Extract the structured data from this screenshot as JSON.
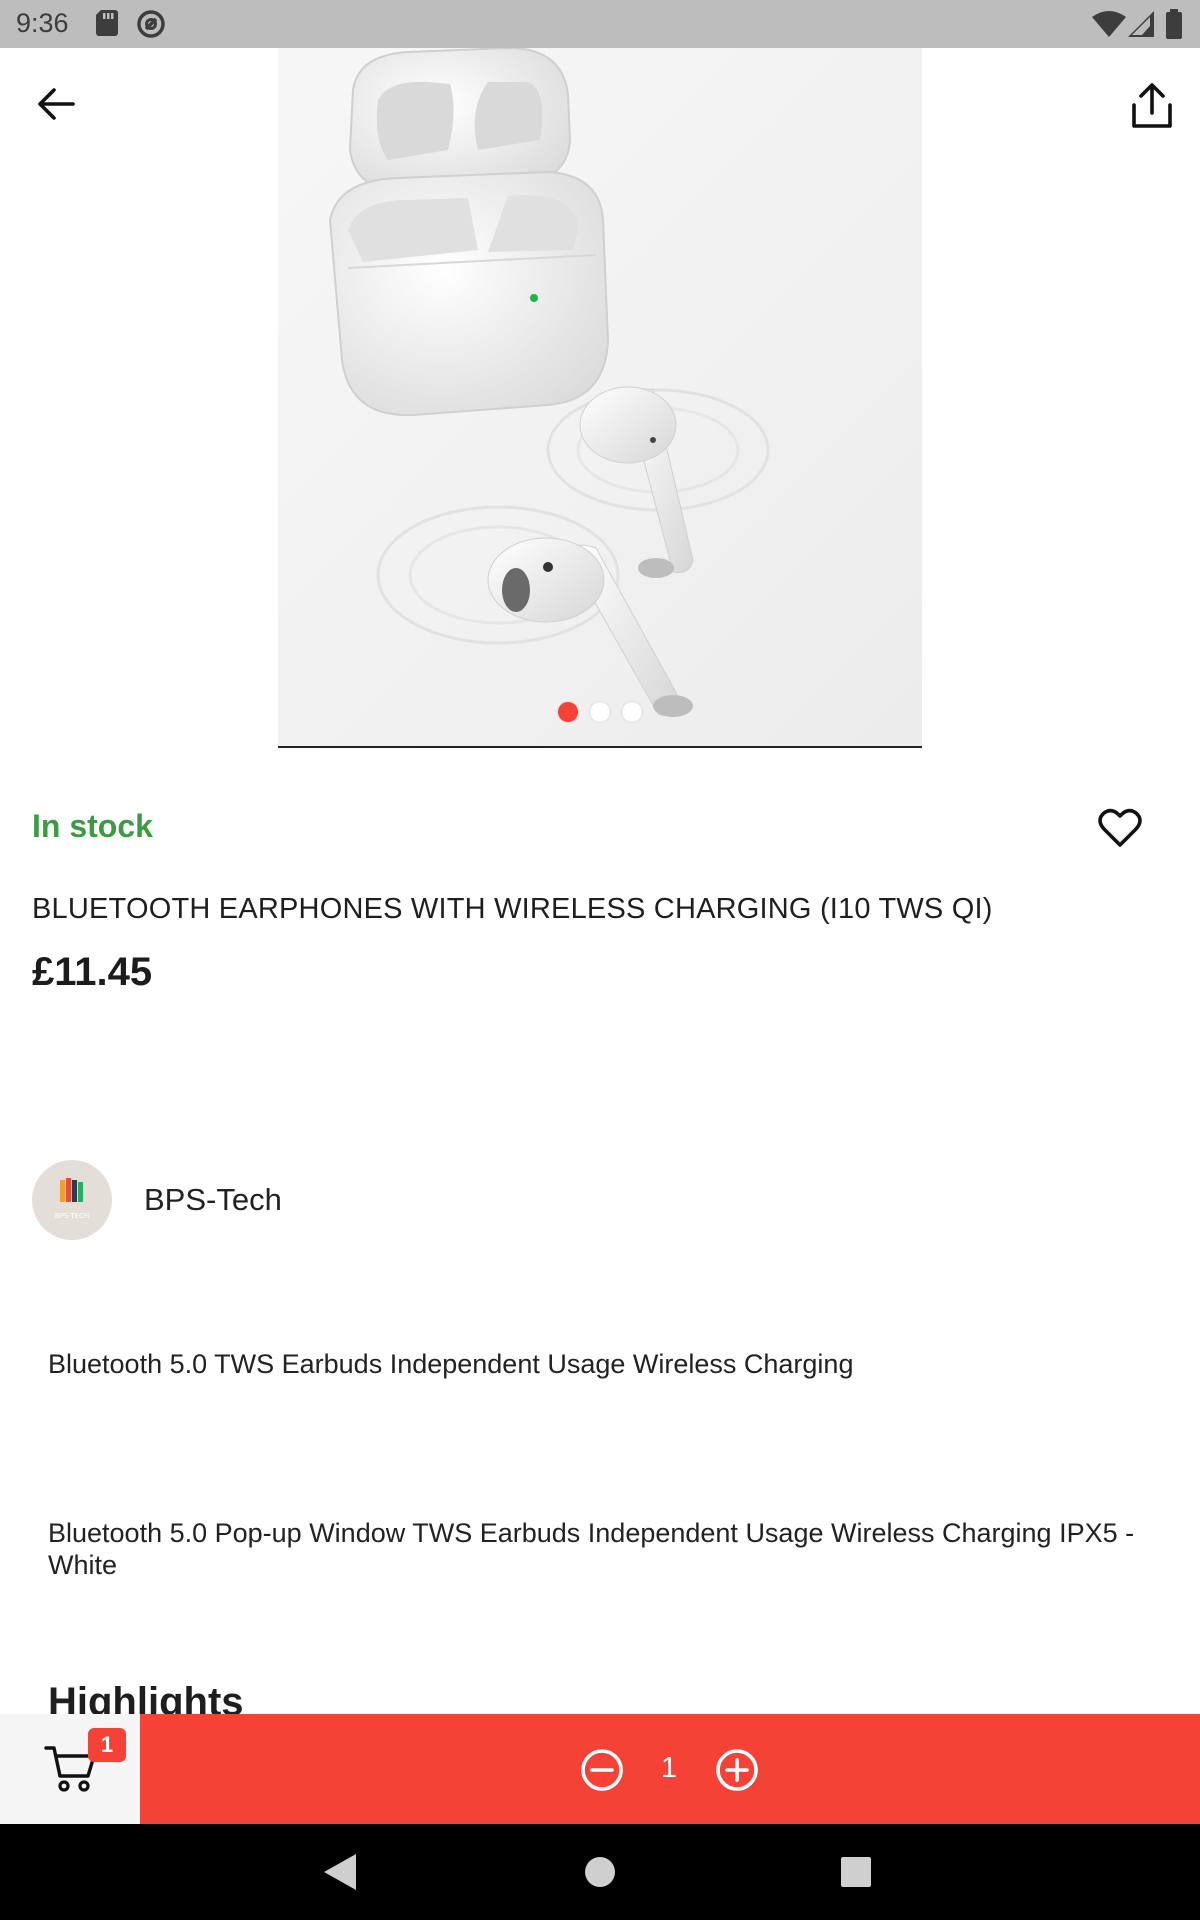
{
  "status_bar": {
    "time": "9:36",
    "left_icons": [
      "sd-card-icon",
      "no-sync-icon"
    ],
    "right_icons": [
      "wifi-icon",
      "signal-icon",
      "battery-icon"
    ]
  },
  "app_bar": {
    "back_icon": "arrow-left-icon",
    "share_icon": "share-icon"
  },
  "carousel": {
    "image": "white wireless earbuds with charging case",
    "page_count": 3,
    "active_index": 0
  },
  "product": {
    "stock_status": "In stock",
    "title": "BLUETOOTH EARPHONES WITH WIRELESS CHARGING (I10 TWS QI)",
    "price": "£11.45",
    "favorite_icon": "heart-outline-icon"
  },
  "seller": {
    "name": "BPS-Tech"
  },
  "descriptions": [
    "Bluetooth 5.0 TWS Earbuds Independent Usage Wireless Charging",
    "Bluetooth 5.0 Pop-up Window TWS Earbuds Independent Usage Wireless Charging IPX5 - White"
  ],
  "highlights_heading": "Highlights",
  "bottom_bar": {
    "cart_count": "1",
    "quantity": "1",
    "decrement_icon": "minus-circle-icon",
    "increment_icon": "plus-circle-icon"
  },
  "colors": {
    "accent": "#f44336",
    "in_stock": "#3b9b43"
  }
}
